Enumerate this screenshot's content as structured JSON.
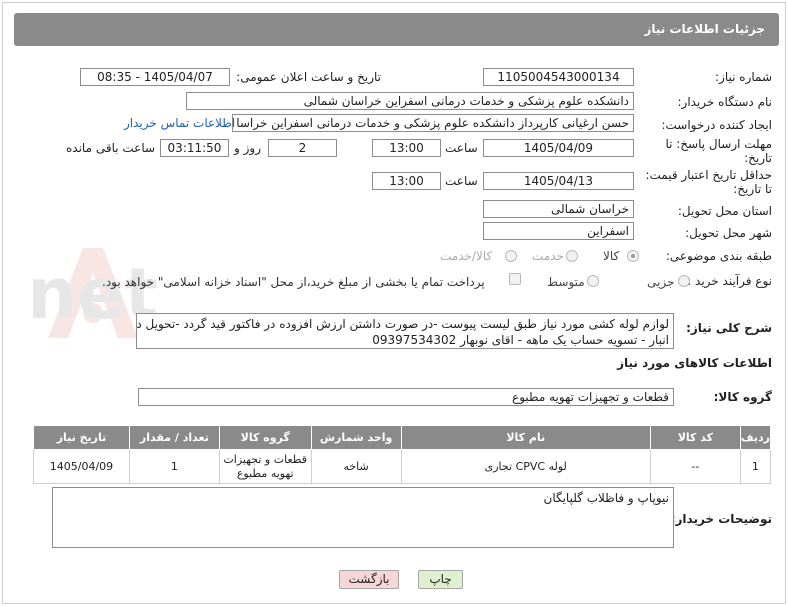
{
  "header": {
    "title": "جزئیات اطلاعات نیاز"
  },
  "fields": {
    "need_number_label": "شماره نیاز:",
    "need_number": "1105004543000134",
    "announce_label": "تاریخ و ساعت اعلان عمومی:",
    "announce_value": "1405/04/07 - 08:35",
    "buyer_org_label": "نام دستگاه خریدار:",
    "buyer_org": "دانشکده علوم پزشکی و خدمات درمانی اسفراین خراسان شمالی",
    "creator_label": "ایجاد کننده درخواست:",
    "creator": "حسن ارغیانی کارپرداز  دانشکده علوم پزشکی و خدمات درمانی اسفراین خراسا",
    "contact_link": "اطلاعات تماس خریدار",
    "deadline_label_1": "مهلت ارسال پاسخ: تا",
    "deadline_label_2": "تاریخ:",
    "deadline_date": "1405/04/09",
    "time_label": "ساعت",
    "deadline_time": "13:00",
    "days": "2",
    "days_label": "روز و",
    "remaining_time": "03:11:50",
    "remaining_label": "ساعت باقی مانده",
    "validity_label_1": "حداقل تاریخ اعتبار قیمت:",
    "validity_label_2": "تا تاریخ:",
    "validity_date": "1405/04/13",
    "validity_time_label": "ساعت",
    "validity_time": "13:00",
    "province_label": "استان محل تحویل:",
    "province": "خراسان شمالی",
    "city_label": "شهر محل تحویل:",
    "city": "اسفراین",
    "category_label": "طبقه بندی موضوعی:",
    "category_options": [
      "کالا",
      "خدمت",
      "کالا/خدمت"
    ],
    "process_label": "نوع فرآیند خرید :",
    "process_options": [
      "جزیی",
      "متوسط"
    ],
    "payment_note": "پرداخت تمام یا بخشی از مبلغ خرید،از محل \"اسناد خزانه اسلامی\" خواهد بود."
  },
  "summary": {
    "label": "شرح کلی نیاز:",
    "line1": "لوازم لوله کشی  مورد نیاز طبق لیست پیوست -در صورت داشتن ارزش افزوده در فاکتور قید گردد -تحویل درب",
    "line2": "انبار - تسویه حساب یک ماهه - اقای نوبهار 09397534302"
  },
  "goods_section": {
    "title": "اطلاعات کالاهای مورد نیاز",
    "group_label": "گروه کالا:",
    "group_value": "قطعات و تجهیزات تهویه مطبوع"
  },
  "table": {
    "headers": [
      "ردیف",
      "کد کالا",
      "نام کالا",
      "واحد شمارش",
      "گروه کالا",
      "تعداد / مقدار",
      "تاریخ نیاز"
    ],
    "rows": [
      {
        "row": "1",
        "code": "--",
        "name": "لوله CPVC تجاری",
        "unit": "شاخه",
        "group_line1": "قطعات و تجهیزات",
        "group_line2": "تهویه مطبوع",
        "qty": "1",
        "date": "1405/04/09"
      }
    ]
  },
  "buyer_notes": {
    "label": "توضیحات خریدار:",
    "text": "نیوپاپ و فاظلاب گلپایگان"
  },
  "buttons": {
    "print": "چاپ",
    "back": "بازگشت"
  },
  "colors": {
    "header_bg": "#8a8a8a",
    "link": "#1f5fb3",
    "back_btn": "#f6d6d6",
    "print_btn": "#dff0cf"
  },
  "watermark": {
    "text": "AriaTender.net"
  }
}
